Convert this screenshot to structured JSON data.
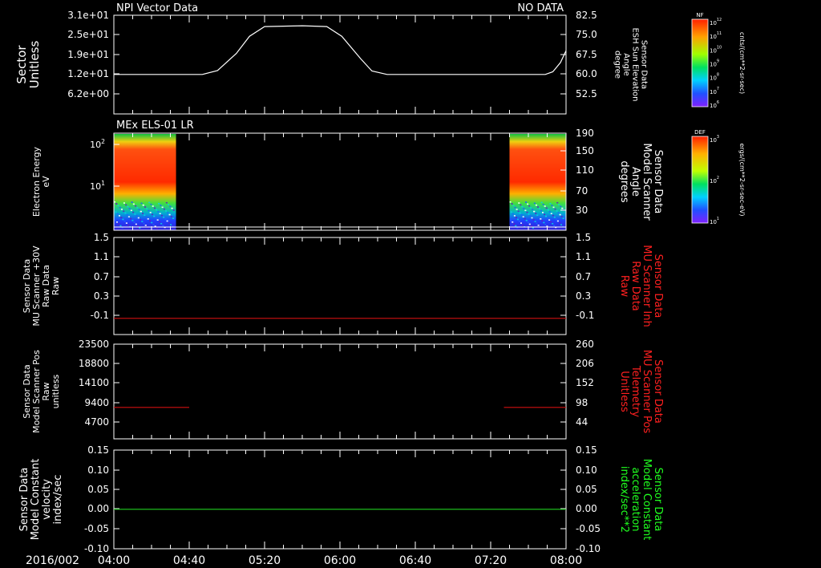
{
  "header": {
    "left_title": "NPI Vector Data",
    "right_title": "NO DATA",
    "date": "2016/002"
  },
  "time_axis": {
    "ticks": [
      "04:00",
      "04:40",
      "05:20",
      "06:00",
      "06:40",
      "07:20",
      "08:00"
    ],
    "range_minutes": [
      0,
      240
    ]
  },
  "colorbars": [
    {
      "label": "NF",
      "unit": "cnts/(cm**2-sr-sec)",
      "tick_labels": [
        "10^12",
        "10^11",
        "10^10",
        "10^9",
        "10^8",
        "10^7",
        "10^6"
      ]
    },
    {
      "label": "DEF",
      "unit": "ergs/(cm**2-sr-sec-eV)",
      "tick_labels": [
        "10^3",
        "10^2",
        "10^1"
      ]
    }
  ],
  "chart_data": [
    {
      "type": "line",
      "panel": "npi",
      "left_axis": {
        "label_lines": [
          "Sector",
          "Unitless"
        ],
        "tick_labels": [
          "3.1e+01",
          "2.5e+01",
          "1.9e+01",
          "1.2e+01",
          "6.2e+00"
        ]
      },
      "right_axis": {
        "label_lines": [
          "Sensor Data",
          "ESH Sun Elevation",
          "Angle",
          "degree"
        ],
        "tick_labels": [
          "82.5",
          "75.0",
          "67.5",
          "60.0",
          "52.5"
        ],
        "ylim": [
          45,
          82.5
        ]
      },
      "series": [
        {
          "color": "#ffffff",
          "x_minutes": [
            0,
            47,
            55,
            65,
            72,
            80,
            100,
            113,
            121,
            131,
            137,
            145,
            200,
            229,
            233,
            237,
            240
          ],
          "y": [
            60.0,
            60.0,
            61.5,
            68.0,
            74.5,
            78.2,
            78.5,
            78.2,
            74.5,
            66.0,
            61.3,
            60.0,
            60.0,
            60.0,
            61.0,
            64.5,
            69.0
          ]
        }
      ]
    },
    {
      "type": "heatmap",
      "panel": "els",
      "title": "MEx ELS-01 LR",
      "left_axis": {
        "label_lines": [
          "Electron Energy",
          "eV"
        ],
        "tick_labels": [
          "10^2",
          "10^1"
        ]
      },
      "right_axis": {
        "label_lines": [
          "Sensor Data",
          "Model Scanner",
          "Angle",
          "degrees"
        ],
        "tick_labels": [
          "190",
          "150",
          "110",
          "70",
          "30"
        ]
      },
      "blocks_minutes": [
        [
          0,
          33
        ],
        [
          210,
          240
        ]
      ],
      "scanner_angle_line": 16
    },
    {
      "type": "line",
      "panel": "mu_scanner",
      "left_axis": {
        "label_lines": [
          "Sensor Data",
          "MU Scanner +30V",
          "Raw Data",
          "Raw"
        ],
        "tick_labels": [
          "1.5",
          "1.1",
          "0.7",
          "0.3",
          "-0.1"
        ]
      },
      "right_axis": {
        "label_lines": [
          "Sensor Data",
          "MU Scanner Inh",
          "Raw Data",
          "Raw"
        ],
        "tick_labels": [
          "1.5",
          "1.1",
          "0.7",
          "0.3",
          "-0.1"
        ],
        "color": "#ff2020"
      },
      "ylim": [
        -0.3,
        1.5
      ],
      "series": [
        {
          "color": "#d01010",
          "x_minutes": [
            0,
            240
          ],
          "y": [
            0.0,
            0.0
          ]
        }
      ]
    },
    {
      "type": "line",
      "panel": "scanner_pos",
      "left_axis": {
        "label_lines": [
          "Sensor Data",
          "Model Scanner Pos",
          "Raw",
          "unitless"
        ],
        "tick_labels": [
          "23500",
          "18800",
          "14100",
          "9400",
          "4700"
        ]
      },
      "right_axis": {
        "label_lines": [
          "Sensor Data",
          "MU Scanner Pos",
          "Telemetry",
          "Unitless"
        ],
        "tick_labels": [
          "260",
          "206",
          "152",
          "98",
          "44"
        ],
        "color": "#ff2020"
      },
      "ylim": [
        0,
        23500
      ],
      "series": [
        {
          "color": "#d01010",
          "x_minutes": [
            0,
            40
          ],
          "y": [
            7800,
            7800
          ]
        },
        {
          "color": "#d01010",
          "x_minutes": [
            207,
            240
          ],
          "y": [
            7800,
            7800
          ]
        }
      ]
    },
    {
      "type": "line",
      "panel": "constant",
      "left_axis": {
        "label_lines": [
          "Sensor Data",
          "Model Constant",
          "velocity",
          "index/sec"
        ],
        "tick_labels": [
          "0.15",
          "0.10",
          "0.05",
          "0.00",
          "-0.05",
          "-0.10"
        ]
      },
      "right_axis": {
        "label_lines": [
          "Sensor Data",
          "Model Constant",
          "acceleration",
          "index/sec**2"
        ],
        "tick_labels": [
          "0.15",
          "0.10",
          "0.05",
          "0.00",
          "-0.05",
          "-0.10"
        ],
        "color": "#20ff20"
      },
      "ylim": [
        -0.1,
        0.15
      ],
      "series": [
        {
          "color": "#20d020",
          "x_minutes": [
            0,
            240
          ],
          "y": [
            0.0,
            0.0
          ]
        }
      ]
    }
  ]
}
